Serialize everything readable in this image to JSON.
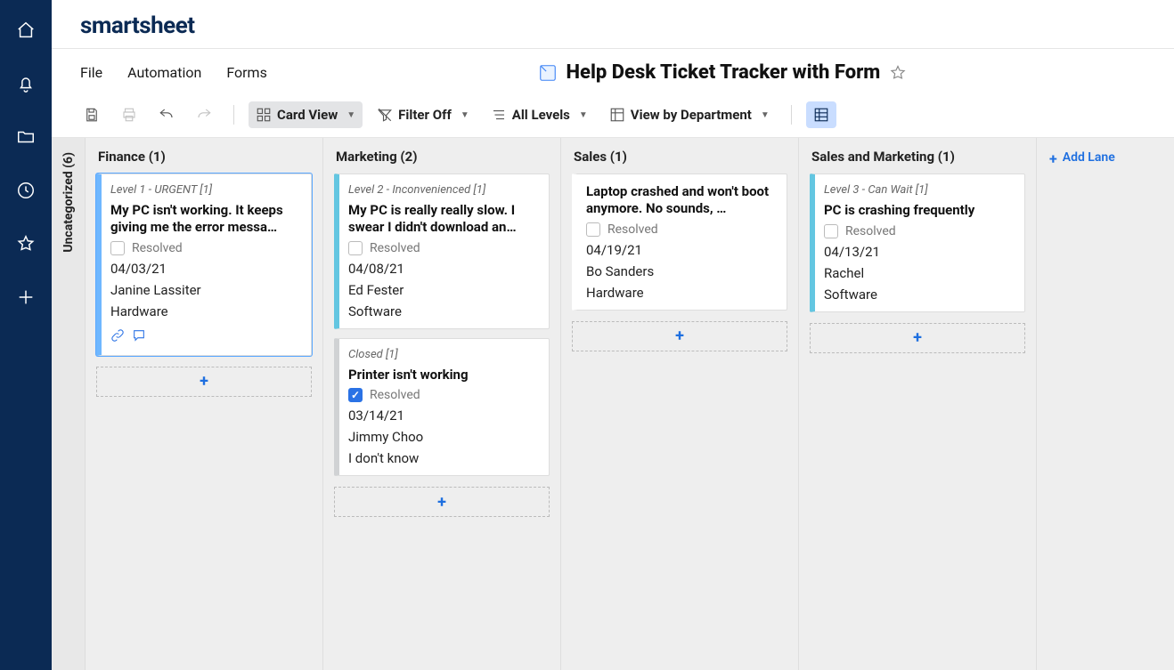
{
  "brand": "smartsheet",
  "menu": {
    "file": "File",
    "automation": "Automation",
    "forms": "Forms"
  },
  "doc_title": "Help Desk Ticket Tracker with Form",
  "toolbar": {
    "card_view": "Card View",
    "filter": "Filter Off",
    "all_levels": "All Levels",
    "view_by": "View by Department"
  },
  "uncategorized_label": "Uncategorized (6)",
  "add_lane_label": "Add Lane",
  "resolved_label": "Resolved",
  "lanes": [
    {
      "header": "Finance (1)",
      "cards": [
        {
          "priority": "Level 1 - URGENT [1]",
          "title": "My PC isn't working. It keeps giving me the error messa…",
          "resolved": false,
          "date": "04/03/21",
          "person": "Janine Lassiter",
          "category": "Hardware",
          "stripe": "blue",
          "has_footer": true
        }
      ]
    },
    {
      "header": "Marketing (2)",
      "cards": [
        {
          "priority": "Level 2 - Inconvenienced [1]",
          "title": "My PC is really really slow. I swear I didn't download an…",
          "resolved": false,
          "date": "04/08/21",
          "person": "Ed Fester",
          "category": "Software",
          "stripe": "teal",
          "has_footer": false
        },
        {
          "priority": "Closed [1]",
          "title": "Printer isn't working",
          "resolved": true,
          "date": "03/14/21",
          "person": "Jimmy Choo",
          "category": "I don't know",
          "stripe": "gray",
          "has_footer": false
        }
      ]
    },
    {
      "header": "Sales (1)",
      "cards": [
        {
          "priority": "",
          "title": "Laptop crashed and won't boot anymore. No sounds, …",
          "resolved": false,
          "date": "04/19/21",
          "person": "Bo Sanders",
          "category": "Hardware",
          "stripe": "none",
          "has_footer": false
        }
      ]
    },
    {
      "header": "Sales and Marketing (1)",
      "cards": [
        {
          "priority": "Level 3 - Can Wait [1]",
          "title": "PC is crashing frequently",
          "resolved": false,
          "date": "04/13/21",
          "person": "Rachel",
          "category": "Software",
          "stripe": "teal",
          "has_footer": false
        }
      ]
    }
  ]
}
